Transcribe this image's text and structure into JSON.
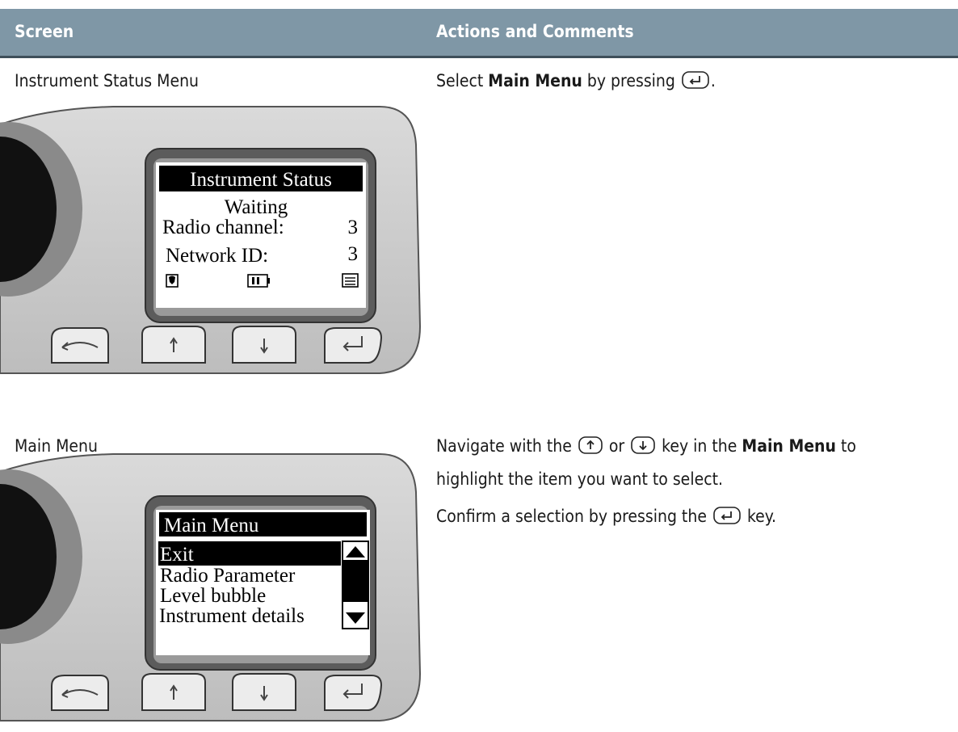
{
  "header": {
    "col1": "Screen",
    "col2": "Actions and Comments"
  },
  "row1": {
    "label": "Instrument Status Menu",
    "action_pre": "Select ",
    "action_bold": "Main Menu",
    "action_mid": " by pressing ",
    "action_post": ".",
    "lcd": {
      "title": "Instrument Status",
      "status": "Waiting",
      "line1_label": "Radio channel:",
      "line1_value": "3",
      "line2_label": "Network ID:",
      "line2_value": "3"
    }
  },
  "row2": {
    "label": "Main Menu",
    "p1_pre": "Navigate with the ",
    "p1_or": " or ",
    "p1_mid": " key in the ",
    "p1_bold": "Main Menu",
    "p1_post": " to",
    "p1_line2": "highlight the item you want to select.",
    "p2_pre": "Confirm a selection by pressing the ",
    "p2_post": " key.",
    "lcd": {
      "title": "Main Menu",
      "items": [
        "Exit",
        "Radio Parameter",
        "Level bubble",
        "Instrument details"
      ]
    }
  },
  "icons": {
    "enter": "enter-key-icon",
    "up": "up-arrow-key-icon",
    "down": "down-arrow-key-icon",
    "power": "power-curve-key-icon",
    "battery": "battery-icon",
    "menu": "menu-lines-icon",
    "signal": "status-shield-icon"
  }
}
